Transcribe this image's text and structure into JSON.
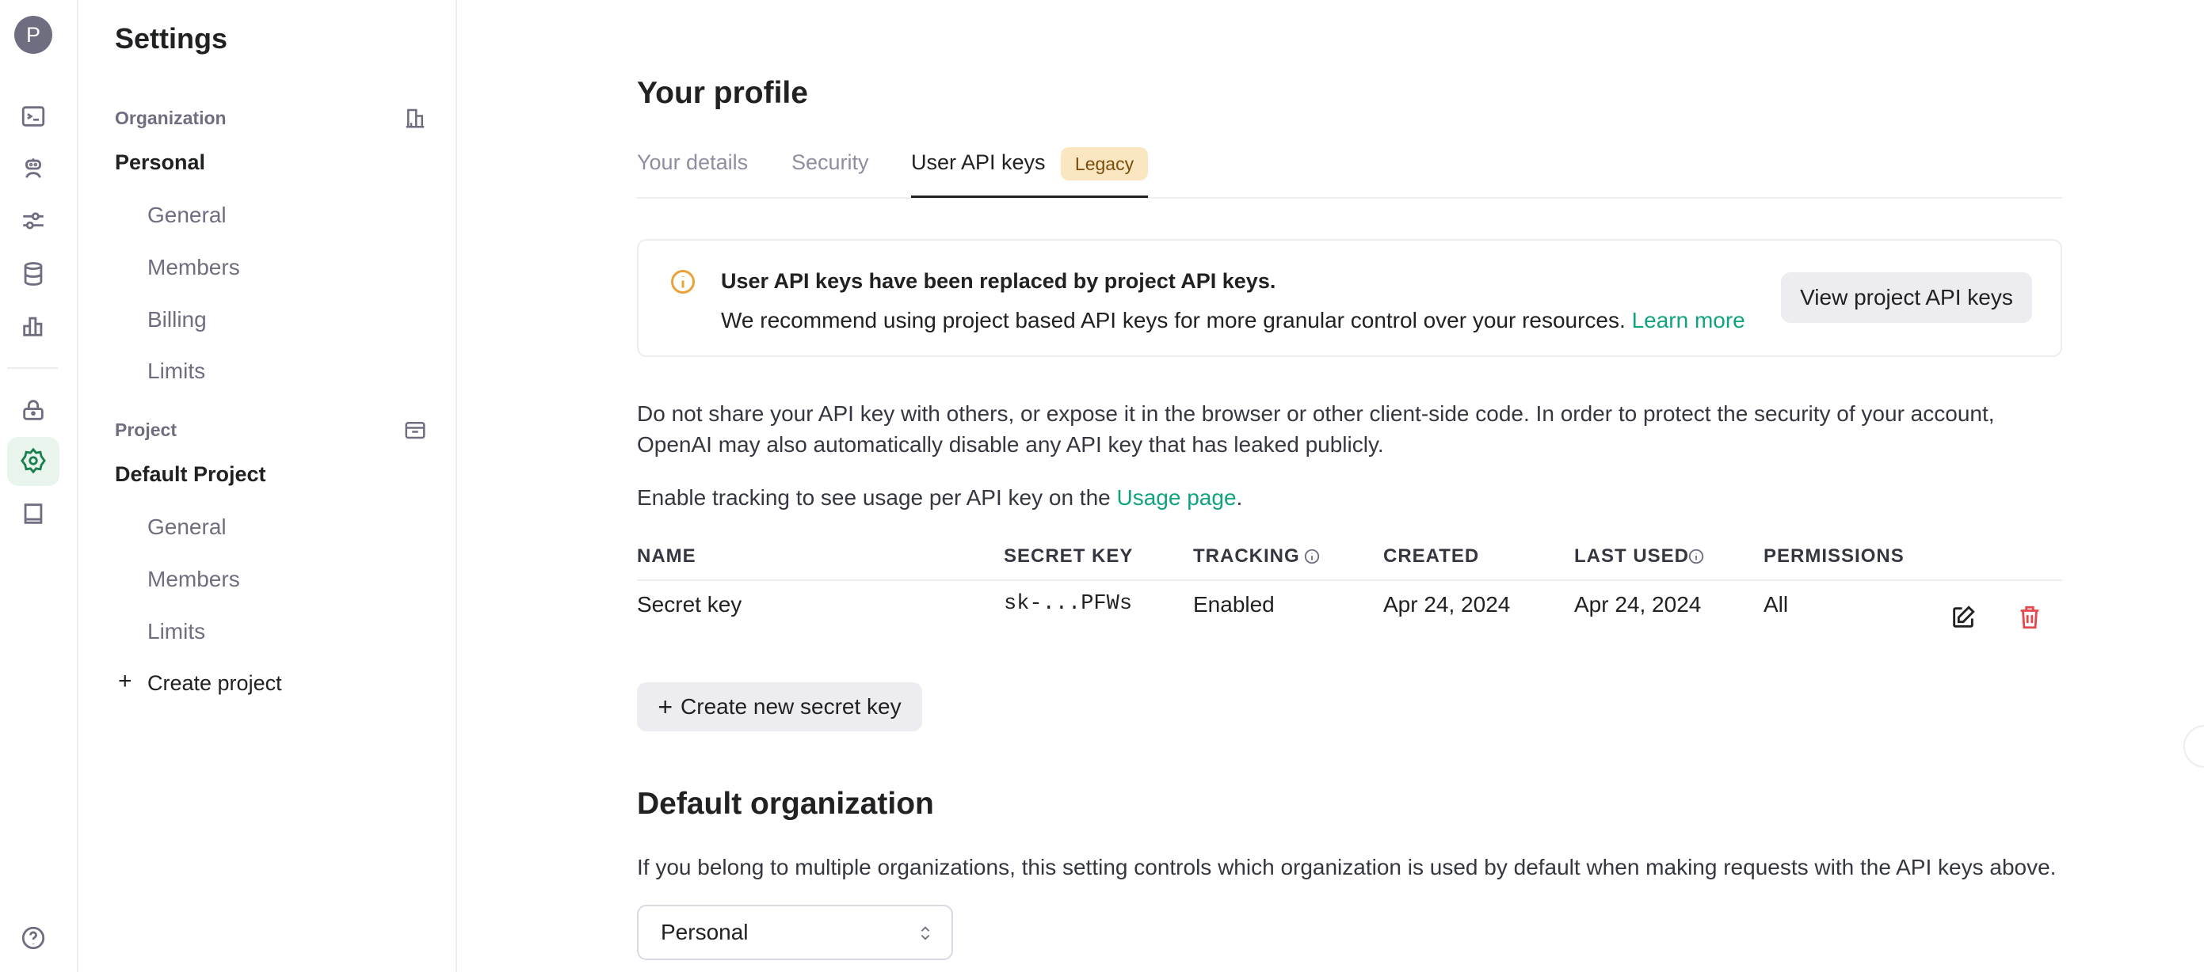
{
  "rail": {
    "avatar_initial": "P",
    "icons": [
      "terminal-icon",
      "assistant-icon",
      "sliders-icon",
      "database-icon",
      "chart-icon",
      "lock-icon",
      "gear-icon",
      "book-icon",
      "help-icon"
    ],
    "active": "gear-icon"
  },
  "settings": {
    "title": "Settings",
    "organization_label": "Organization",
    "organization_name": "Personal",
    "org_items": [
      "General",
      "Members",
      "Billing",
      "Limits"
    ],
    "project_label": "Project",
    "project_name": "Default Project",
    "project_items": [
      "General",
      "Members",
      "Limits"
    ],
    "create_project": "Create project"
  },
  "main": {
    "title": "Your profile",
    "tabs": [
      {
        "label": "Your details"
      },
      {
        "label": "Security"
      },
      {
        "label": "User API keys",
        "active": true,
        "badge": "Legacy"
      }
    ],
    "banner": {
      "title": "User API keys have been replaced by project API keys.",
      "text": "We recommend using project based API keys for more granular control over your resources.",
      "link": "Learn more",
      "button": "View project API keys"
    },
    "warning_1": "Do not share your API key with others, or expose it in the browser or other client-side code. In order to protect the security of your account,",
    "warning_2": "OpenAI may also automatically disable any API key that has leaked publicly.",
    "tracking_text": "Enable tracking to see usage per API key on the",
    "tracking_link": "Usage page",
    "tracking_end": ".",
    "table": {
      "headers": [
        "NAME",
        "SECRET KEY",
        "TRACKING",
        "CREATED",
        "LAST USED",
        "PERMISSIONS"
      ],
      "rows": [
        [
          "Secret key",
          "sk-...PFWs",
          "Enabled",
          "Apr 24, 2024",
          "Apr 24, 2024",
          "All"
        ]
      ]
    },
    "create_key_button": "Create new secret key",
    "default_org": {
      "title": "Default organization",
      "description": "If you belong to multiple organizations, this setting controls which organization is used by default when making requests with the API keys above.",
      "selected": "Personal"
    }
  },
  "colors": {
    "accent": "#10a37f",
    "badge_bg": "#fbe6c2",
    "badge_text": "#7a4d0b",
    "warning_icon": "#e8a33a",
    "delete": "#e5484d"
  }
}
